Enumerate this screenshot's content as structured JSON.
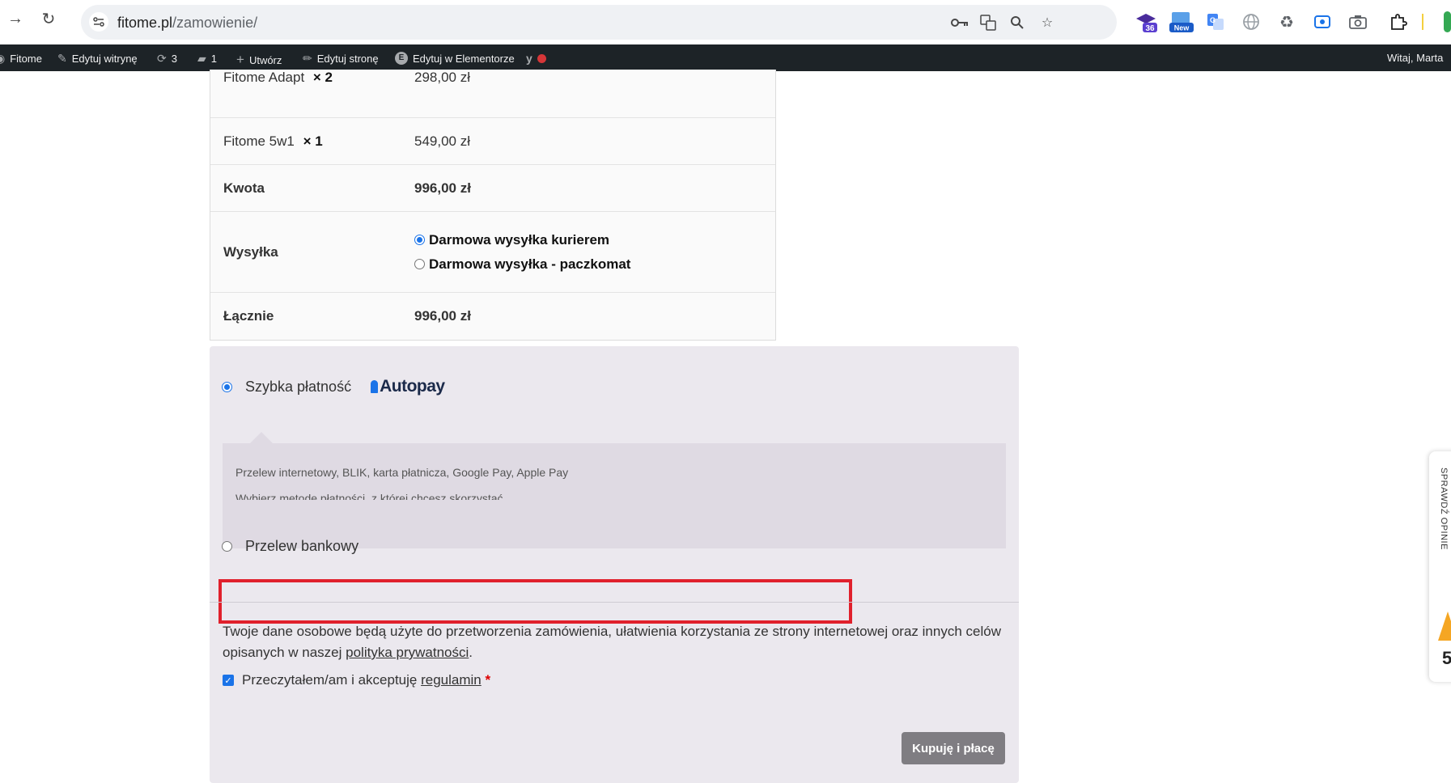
{
  "browser": {
    "url_host": "fitome.pl",
    "url_path": "/zamowienie/",
    "ext_badges": {
      "grad": "36",
      "new": "New"
    }
  },
  "adminbar": {
    "site": "Fitome",
    "customize": "Edytuj witrynę",
    "updates": "3",
    "comments": "1",
    "new": "Utwórz",
    "edit": "Edytuj stronę",
    "elementor": "Edytuj w Elementorze",
    "greeting": "Witaj, Marta"
  },
  "order": {
    "items": [
      {
        "name": "Fitome Adapt",
        "qty": "× 2",
        "price": "298,00 zł"
      },
      {
        "name": "Fitome 5w1",
        "qty": "× 1",
        "price": "549,00 zł"
      }
    ],
    "subtotal_label": "Kwota",
    "subtotal": "996,00 zł",
    "shipping_label": "Wysyłka",
    "shipping_options": [
      "Darmowa wysyłka kurierem",
      "Darmowa wysyłka - paczkomat"
    ],
    "total_label": "Łącznie",
    "total": "996,00 zł"
  },
  "payment": {
    "fast_label": "Szybka płatność",
    "autopay_logo": "Autopay",
    "desc_line1": "Przelew internetowy, BLIK, karta płatnicza, Google Pay, Apple Pay",
    "desc_line2": "Wybierz metodę płatności, z której chcesz skorzystać",
    "bank_label": "Przelew bankowy",
    "privacy_text": "Twoje dane osobowe będą użyte do przetworzenia zamówienia, ułatwienia korzystania ze strony internetowej oraz innych celów opisanych w naszej ",
    "privacy_link": "polityka prywatności",
    "privacy_end": ".",
    "terms_text": "Przeczytałem/am i akceptuję ",
    "terms_link": "regulamin",
    "terms_req": "*",
    "buy_button": "Kupuję i płacę"
  },
  "review_tab": {
    "label": "SPRAWDŹ OPINIE",
    "number": "5"
  },
  "colors": {
    "accent": "#1a73e8",
    "highlight": "#e0202c",
    "admin_bar": "#1d2327",
    "payment_bg": "#ebe8ee"
  }
}
